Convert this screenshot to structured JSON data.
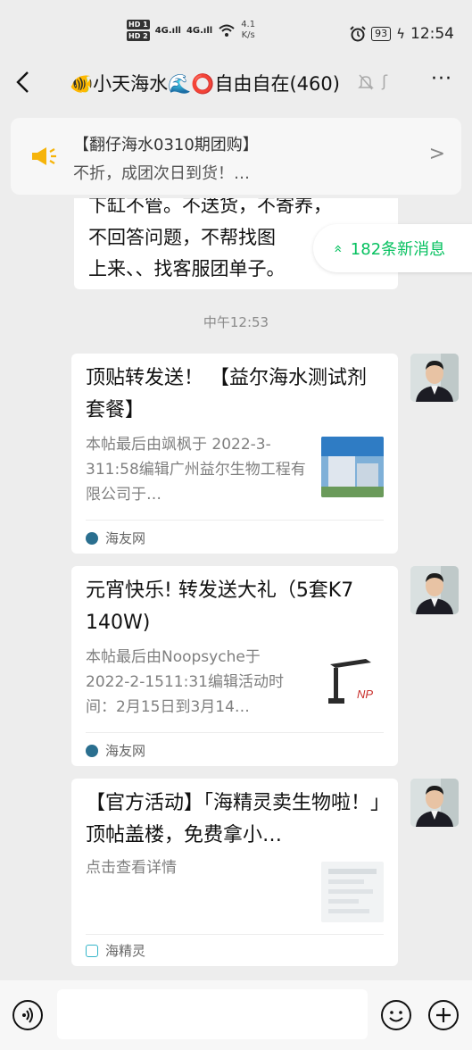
{
  "status_bar": {
    "hd1": "HD 1",
    "hd2": "HD 2",
    "sig1": "4G.ıll",
    "sig2": "4G.ıll",
    "speed_value": "4.1",
    "speed_unit": "K/s",
    "battery": "93",
    "time": "12:54"
  },
  "nav": {
    "back": "<",
    "title": "🐠小天海水🌊⭕自由自在(460)",
    "more": "···"
  },
  "pinned": {
    "line1": "【翻仔海水0310期团购】",
    "line2": "不折，成团次日到货！…",
    "chevron": ">"
  },
  "prev_message": {
    "line1": "下缸不管。不送货，不寄养，",
    "line2": "不回答问题，不帮找图",
    "line3": "上来、、找客服团单子。"
  },
  "new_messages": {
    "arrow": "»",
    "label": "182条新消息"
  },
  "timestamp": "中午12:53",
  "cards": [
    {
      "title": "顶贴转发送！ 【益尔海水测试剂套餐】",
      "desc": "本帖最后由飒枫于 2022-3-311:58编辑广州益尔生物工程有限公司于…",
      "source": "海友网"
    },
    {
      "title": "元宵快乐! 转发送大礼（5套K7 140W)",
      "desc": "本帖最后由Noopsyche于 2022-2-1511:31编辑活动时间：2月15日到3月14…",
      "source": "海友网"
    },
    {
      "title": "【官方活动】「海精灵卖生物啦！」顶帖盖楼，免费拿小…",
      "desc": "点击查看详情",
      "source": "海精灵"
    }
  ],
  "colors": {
    "accent_green": "#07c160",
    "background": "#ededed",
    "horn_yellow": "#f6b40a"
  },
  "icons": {
    "back": "chevron-left-icon",
    "mute": "bell-off-icon",
    "ear": "ear-icon",
    "more": "more-dots-icon",
    "pinned": "megaphone-icon",
    "voice": "voice-icon",
    "emoji": "emoji-icon",
    "plus": "plus-icon"
  }
}
